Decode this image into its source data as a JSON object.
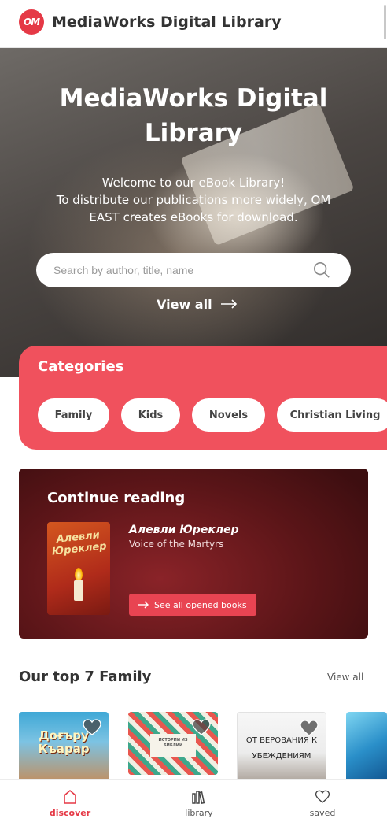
{
  "header": {
    "logo_text": "ОМ",
    "title": "MediaWorks Digital Library"
  },
  "hero": {
    "title": "MediaWorks Digital Library",
    "welcome": "Welcome to our eBook Library!",
    "description": "To distribute our publications more widely, OM EAST creates eBooks for download.",
    "search_placeholder": "Search by author, title, name",
    "view_all": "View all"
  },
  "categories": {
    "title": "Categories",
    "items": [
      "Family",
      "Kids",
      "Novels",
      "Christian Living"
    ]
  },
  "continue_reading": {
    "title": "Continue reading",
    "book_title": "Алевли Юреклер",
    "book_author": "Voice of the Martyrs",
    "cover_text": "Алевли Юреклер",
    "see_all": "See all opened books"
  },
  "top": {
    "title": "Our top 7 Family",
    "view_all": "View all",
    "books": [
      {
        "cover_text": "Доғъру Къарар"
      },
      {
        "cover_text": "ИСТОРИИ ИЗ БИБЛИИ"
      },
      {
        "cover_text": "ОТ ВЕРОВАНИЯ К УБЕЖДЕНИЯМ"
      },
      {
        "cover_text": ""
      }
    ]
  },
  "bottom_nav": {
    "items": [
      {
        "label": "discover",
        "icon": "home-icon",
        "active": true
      },
      {
        "label": "library",
        "icon": "books-icon",
        "active": false
      },
      {
        "label": "saved",
        "icon": "heart-icon",
        "active": false
      }
    ]
  },
  "colors": {
    "accent": "#e53946",
    "category_bg": "#f0515d",
    "continue_bg": "#5b1518"
  }
}
